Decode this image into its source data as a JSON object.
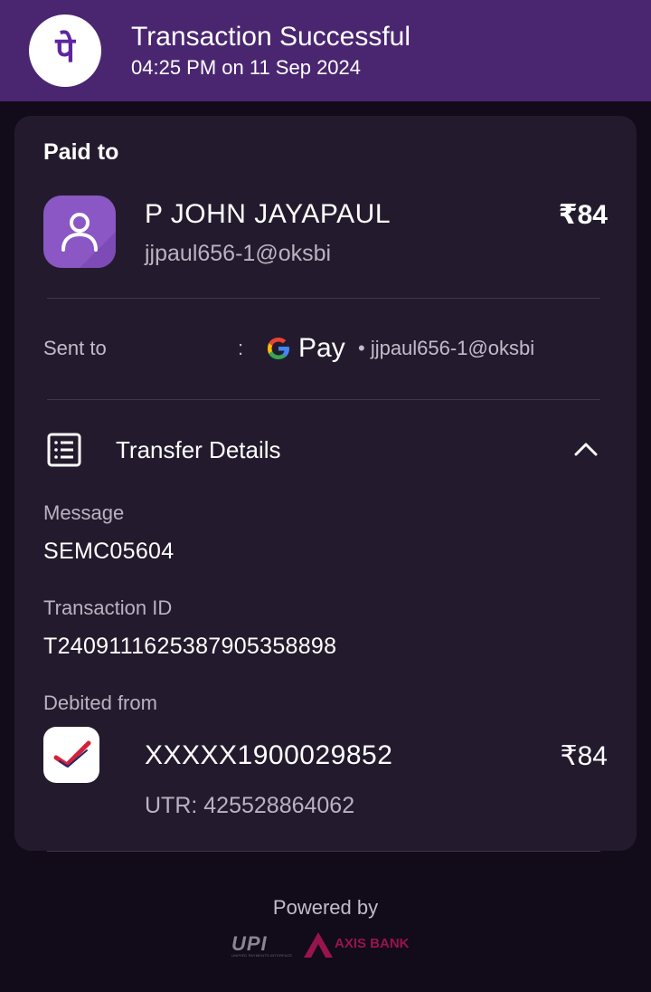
{
  "header": {
    "logo_glyph": "पे",
    "title": "Transaction Successful",
    "datetime": "04:25 PM on 11 Sep 2024",
    "background_color": "#4a2670"
  },
  "paid_to": {
    "label": "Paid to",
    "name": "P  JOHN JAYAPAUL",
    "upi_id": "jjpaul656-1@oksbi",
    "amount": "₹84",
    "avatar_icon": "person-icon",
    "avatar_color": "#8b57c4"
  },
  "sent_to": {
    "label": "Sent to",
    "separator": ":",
    "app_icon": "google-g-icon",
    "app_name": "Pay",
    "upi_id": "• jjpaul656-1@oksbi"
  },
  "transfer_details": {
    "icon": "list-details-icon",
    "title": "Transfer Details",
    "expanded_icon": "chevron-up-icon",
    "fields": [
      {
        "label": "Message",
        "value": "SEMC05604"
      },
      {
        "label": "Transaction ID",
        "value": "T2409111625387905358898"
      }
    ],
    "debited_from": {
      "label": "Debited from",
      "bank_icon": "bank-check-icon",
      "account": "XXXXX1900029852",
      "amount": "₹84",
      "utr": "UTR: 425528864062"
    }
  },
  "footer": {
    "powered_by": "Powered by",
    "upi_logo": "UPI",
    "upi_tagline": "UNIFIED PAYMENTS INTERFACE",
    "bank_logo": "AXIS BANK",
    "bank_color": "#97144d"
  }
}
